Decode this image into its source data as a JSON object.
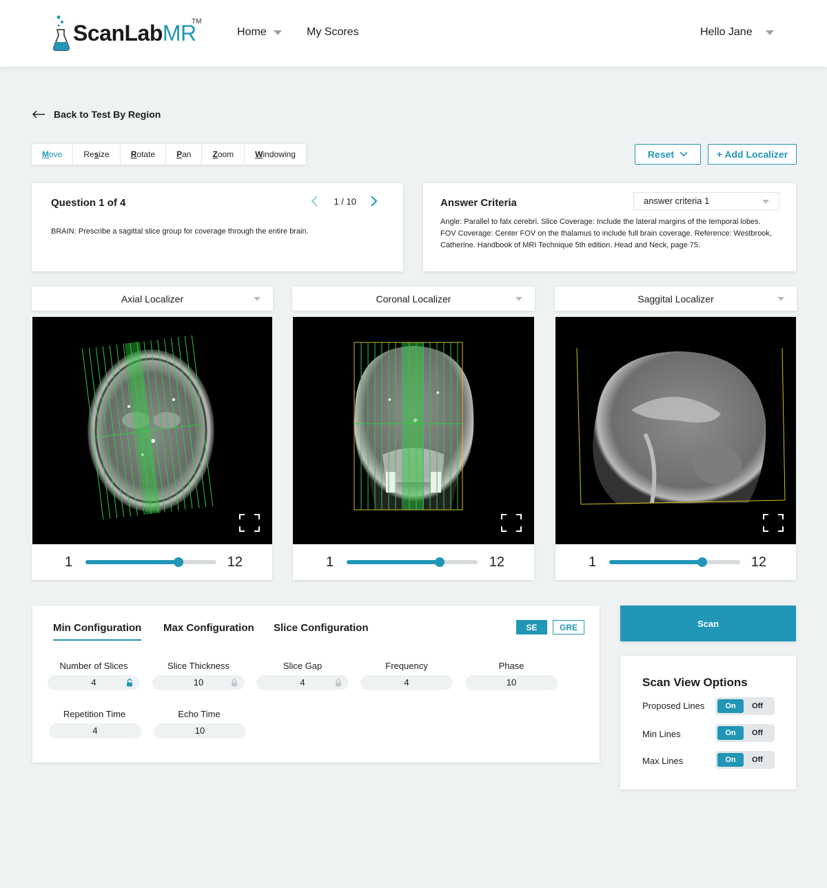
{
  "header": {
    "logo_main": "ScanLab",
    "logo_accent": "MR",
    "logo_tm": "TM",
    "nav": {
      "home": "Home",
      "scores": "My Scores"
    },
    "user_greeting": "Hello Jane"
  },
  "back_link": "Back to Test By Region",
  "toolbar": {
    "tools": [
      {
        "underlined": "M",
        "rest": "ove"
      },
      {
        "pre": "Re",
        "underlined": "s",
        "rest": "ize"
      },
      {
        "underlined": "R",
        "rest": "otate"
      },
      {
        "underlined": "P",
        "rest": "an"
      },
      {
        "underlined": "Z",
        "rest": "oom"
      },
      {
        "underlined": "W",
        "rest": "indowing"
      }
    ],
    "reset_label": "Reset",
    "add_localizer_label": "+ Add Localizer"
  },
  "question": {
    "title": "Question 1 of 4",
    "pager": "1 / 10",
    "text": "BRAIN: Prescribe a sagittal slice group for coverage through the entire brain."
  },
  "answer": {
    "title": "Answer Criteria",
    "select_value": "answer criteria 1",
    "text": "Angle: Parallel to falx cerebri. Slice Coverage: Include the lateral margins of the temporal lobes. FOV Coverage: Center FOV on the thalamus to include full brain coverage. Reference: Westbrook, Catherine. Handbook of MRI Technique 5th edition. Head and Neck, page 75."
  },
  "localizers": [
    {
      "label": "Axial Localizer",
      "slider_min": "1",
      "slider_max": "12",
      "slider_fraction": 0.71
    },
    {
      "label": "Coronal Localizer",
      "slider_min": "1",
      "slider_max": "12",
      "slider_fraction": 0.71
    },
    {
      "label": "Saggital Localizer",
      "slider_min": "1",
      "slider_max": "12",
      "slider_fraction": 0.71
    }
  ],
  "config": {
    "tabs": [
      "Min Configuration",
      "Max Configuration",
      "Slice Configuration"
    ],
    "seq_buttons": [
      "SE",
      "GRE"
    ],
    "fields": [
      {
        "label": "Number of Slices",
        "value": "4"
      },
      {
        "label": "Slice Thickness",
        "value": "10"
      },
      {
        "label": "Slice Gap",
        "value": "4"
      },
      {
        "label": "Frequency",
        "value": "4"
      },
      {
        "label": "Phase",
        "value": "10"
      },
      {
        "label": "Repetition Time",
        "value": "4"
      },
      {
        "label": "Echo Time",
        "value": "10"
      }
    ]
  },
  "scan_label": "Scan",
  "view_options": {
    "title": "Scan View Options",
    "rows": [
      {
        "label": "Proposed Lines",
        "on": "On",
        "off": "Off"
      },
      {
        "label": "Min Lines",
        "on": "On",
        "off": "Off"
      },
      {
        "label": "Max Lines",
        "on": "On",
        "off": "Off"
      }
    ]
  },
  "colors": {
    "accent": "#2196b6",
    "background": "#eff2f3",
    "overlay_green": "#2ecc40",
    "overlay_yellow": "#d4c21a"
  }
}
